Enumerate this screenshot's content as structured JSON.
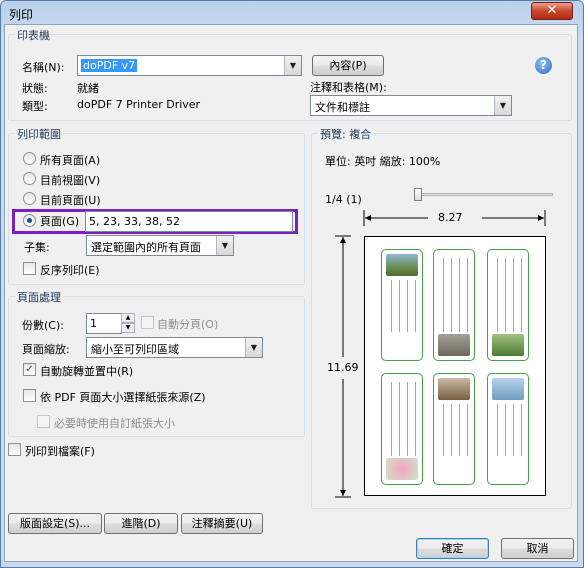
{
  "window": {
    "title": "列印",
    "close_glyph": "✕"
  },
  "printer": {
    "legend": "印表機",
    "name_label": "名稱(N):",
    "name_value": "doPDF v7",
    "status_label": "狀態:",
    "status_value": "就緒",
    "type_label": "類型:",
    "type_value": "doPDF 7 Printer Driver",
    "properties_button": "內容(P)",
    "help_glyph": "?",
    "comments_label": "注釋和表格(M):",
    "comments_value": "文件和標註"
  },
  "range": {
    "legend": "列印範圍",
    "all_pages": "所有頁面(A)",
    "current_view": "目前視圖(V)",
    "current_page": "目前頁面(U)",
    "pages_label": "頁面(G)",
    "pages_value": "5, 23, 33, 38, 52",
    "subset_label": "子集:",
    "subset_value": "選定範圍內的所有頁面",
    "reverse": "反序列印(E)"
  },
  "handling": {
    "legend": "頁面處理",
    "copies_label": "份數(C):",
    "copies_value": "1",
    "collate": "自動分頁(O)",
    "scaling_label": "頁面縮放:",
    "scaling_value": "縮小至可列印區域",
    "auto_rotate": "自動旋轉並置中(R)",
    "choose_source": "依 PDF 頁面大小選擇紙張來源(Z)",
    "custom_paper": "必要時使用自訂紙張大小",
    "check_glyph": "✓"
  },
  "print_to_file": "列印到檔案(F)",
  "preview": {
    "legend": "預覽: 複合",
    "units": "單位: 英吋 縮放: 100%",
    "page_indicator": "1/4 (1)",
    "width": "8.27",
    "height": "11.69"
  },
  "buttons": {
    "page_setup": "版面設定(S)...",
    "advanced": "進階(D)",
    "summarize": "注釋摘要(U)",
    "ok": "確定",
    "cancel": "取消"
  },
  "dropdown_glyph": "▼",
  "spin_up": "▲",
  "spin_down": "▼",
  "colors": {
    "highlight_border": "#7a1fc2",
    "card_border": "#49a14a"
  }
}
